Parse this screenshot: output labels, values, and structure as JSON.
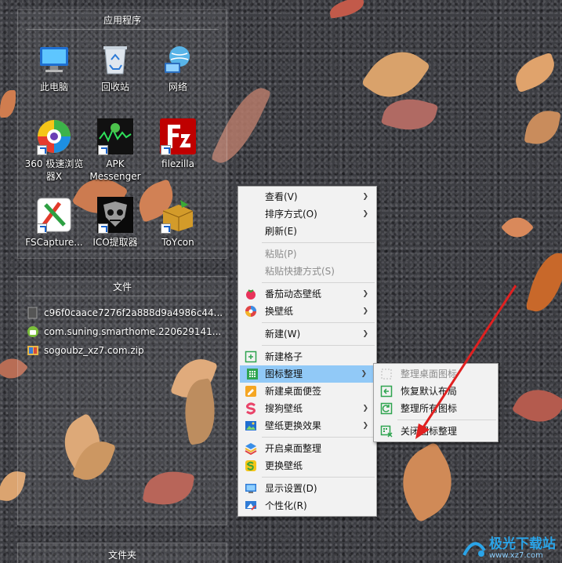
{
  "desktop": {
    "fences": {
      "apps": {
        "title": "应用程序",
        "icons": [
          {
            "label": "此电脑",
            "icon": "computer-icon"
          },
          {
            "label": "回收站",
            "icon": "recycle-bin-icon"
          },
          {
            "label": "网络",
            "icon": "network-icon"
          },
          {
            "label": "360 极速浏览器X",
            "icon": "browser-360-icon"
          },
          {
            "label": "APK Messenger",
            "icon": "apk-messenger-icon"
          },
          {
            "label": "filezilla",
            "icon": "filezilla-icon"
          },
          {
            "label": "FSCapture...",
            "icon": "fscapture-icon"
          },
          {
            "label": "ICO提取器",
            "icon": "ico-extractor-icon"
          },
          {
            "label": "ToYcon",
            "icon": "toycon-icon"
          }
        ]
      },
      "files": {
        "title": "文件",
        "items": [
          {
            "label": "c96f0caace7276f2a888d9a4986c44...",
            "icon": "file-icon"
          },
          {
            "label": "com.suning.smarthome.220629141...",
            "icon": "android-apk-icon"
          },
          {
            "label": "sogoubz_xz7.com.zip",
            "icon": "zip-archive-icon"
          }
        ]
      },
      "folders": {
        "title": "文件夹"
      }
    }
  },
  "context_menu": {
    "items": [
      {
        "label": "查看(V)",
        "submenu": true
      },
      {
        "label": "排序方式(O)",
        "submenu": true
      },
      {
        "label": "刷新(E)"
      },
      {
        "label": "粘贴(P)",
        "disabled": true
      },
      {
        "label": "粘贴快捷方式(S)",
        "disabled": true
      },
      {
        "label": "番茄动态壁纸",
        "submenu": true,
        "icon": "tomato-wallpaper-icon"
      },
      {
        "label": "换壁纸",
        "submenu": true,
        "icon": "change-wallpaper-icon"
      },
      {
        "label": "新建(W)",
        "submenu": true
      },
      {
        "label": "新建格子",
        "icon": "new-grid-icon"
      },
      {
        "label": "图标整理",
        "submenu": true,
        "icon": "icon-organize-icon",
        "highlighted": true
      },
      {
        "label": "新建桌面便签",
        "icon": "desktop-note-icon"
      },
      {
        "label": "搜狗壁纸",
        "submenu": true,
        "icon": "sogou-wallpaper-icon"
      },
      {
        "label": "壁纸更换效果",
        "submenu": true,
        "icon": "wallpaper-effect-icon"
      },
      {
        "label": "开启桌面整理",
        "icon": "desktop-organize-icon"
      },
      {
        "label": "更换壁纸",
        "icon": "replace-wallpaper-icon"
      },
      {
        "label": "显示设置(D)",
        "icon": "display-settings-icon"
      },
      {
        "label": "个性化(R)",
        "icon": "personalize-icon"
      }
    ]
  },
  "submenu": {
    "items": [
      {
        "label": "整理桌面图标",
        "disabled": true,
        "icon": "organize-desktop-icons-icon"
      },
      {
        "label": "恢复默认布局",
        "icon": "restore-layout-icon"
      },
      {
        "label": "整理所有图标",
        "icon": "organize-all-icon"
      },
      {
        "label": "关闭图标整理",
        "icon": "close-organize-icon"
      }
    ]
  },
  "watermark": {
    "line1": "极光下载站",
    "line2": "www.xz7.com"
  },
  "colors": {
    "highlight": "#91c9f7",
    "arrow": "#e02020",
    "menu_bg": "#f2f2f2"
  }
}
